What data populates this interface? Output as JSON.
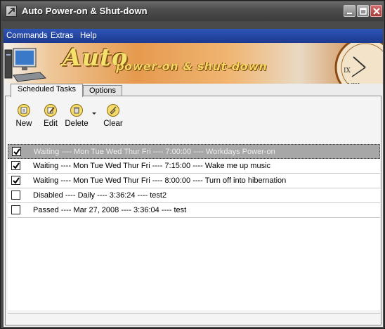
{
  "window": {
    "title": "Auto Power-on & Shut-down"
  },
  "menu": {
    "items": [
      "Commands",
      "Extras",
      "Help"
    ]
  },
  "banner": {
    "word1": "Auto",
    "word2": "power-on & shut-down"
  },
  "tabs": [
    {
      "label": "Scheduled Tasks",
      "active": true
    },
    {
      "label": "Options",
      "active": false
    }
  ],
  "toolbar": {
    "new_label": "New",
    "edit_label": "Edit",
    "delete_label": "Delete",
    "clear_label": "Clear"
  },
  "tasks": [
    {
      "checked": true,
      "selected": true,
      "text": "Waiting ---- Mon Tue Wed Thur Fri  ---- 7:00:00 ---- Workdays Power-on"
    },
    {
      "checked": true,
      "selected": false,
      "text": "Waiting ---- Mon Tue Wed Thur Fri  ---- 7:15:00 ---- Wake me up music"
    },
    {
      "checked": true,
      "selected": false,
      "text": "Waiting ---- Mon Tue Wed Thur Fri  ---- 8:00:00 ---- Turn off into hibernation"
    },
    {
      "checked": false,
      "selected": false,
      "text": "Disabled ---- Daily ---- 3:36:24 ---- test2"
    },
    {
      "checked": false,
      "selected": false,
      "text": "Passed ---- Mar 27,  2008 ---- 3:36:04 ---- test"
    }
  ],
  "colors": {
    "menubar": "#2346a8",
    "selection": "#a7a7a7",
    "title_bar": "#4e4e4e"
  }
}
